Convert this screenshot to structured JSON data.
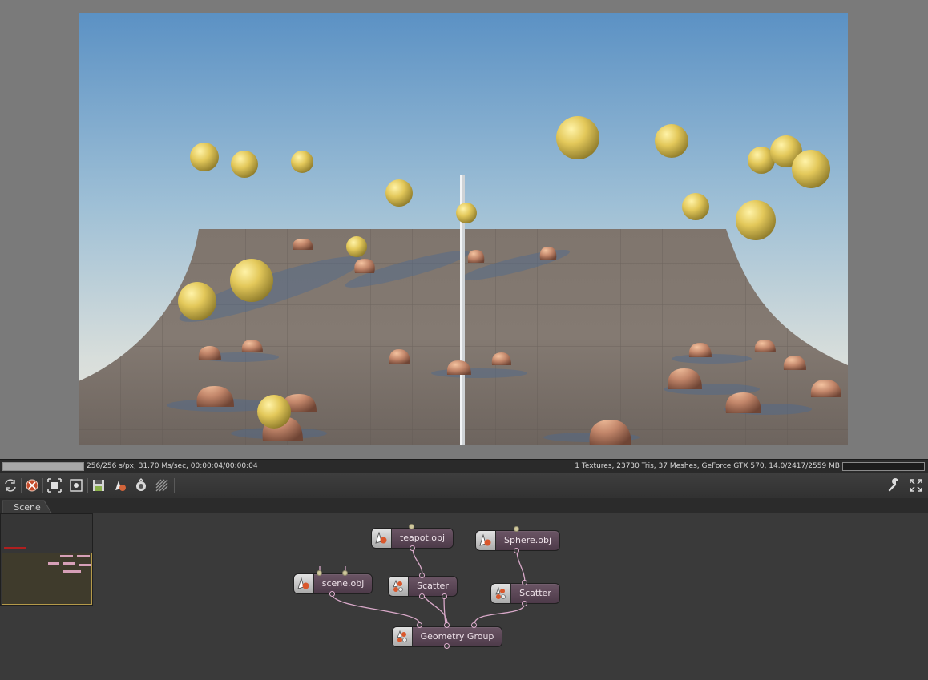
{
  "status": {
    "progress": 1.0,
    "samples_text": "256/256 s/px, 31.70 Ms/sec, 00:00:04/00:00:04",
    "scene_info_text": "1 Textures, 23730 Tris, 37 Meshes, GeForce GTX 570, 14.0/2417/2559 MB",
    "memory_usage": 0.0
  },
  "toolbar": {
    "left_icons": [
      "sync-reload-icon",
      "stop-render-icon",
      "fit-view-icon",
      "zoom-extents-icon",
      "save-render-icon",
      "add-mesh-icon",
      "camera-view-icon",
      "settings-icon"
    ],
    "right_icons": [
      "wrench-icon",
      "fullscreen-icon"
    ]
  },
  "tabs": {
    "scene": "Scene"
  },
  "nodes": {
    "teapot": {
      "label": "teapot.obj",
      "icon": "mesh-node-icon"
    },
    "sphere": {
      "label": "Sphere.obj",
      "icon": "mesh-node-icon"
    },
    "scene": {
      "label": "scene.obj",
      "icon": "mesh-node-icon"
    },
    "scatter1": {
      "label": "Scatter",
      "icon": "scatter-node-icon"
    },
    "scatter2": {
      "label": "Scatter",
      "icon": "scatter-node-icon"
    },
    "group": {
      "label": "Geometry Group",
      "icon": "scatter-node-icon"
    }
  },
  "colors": {
    "node_body": "#5d4858",
    "wire": "#d8a8c8",
    "minimap_frame": "#b59a4a",
    "minimap_marker": "#b01f1f"
  }
}
